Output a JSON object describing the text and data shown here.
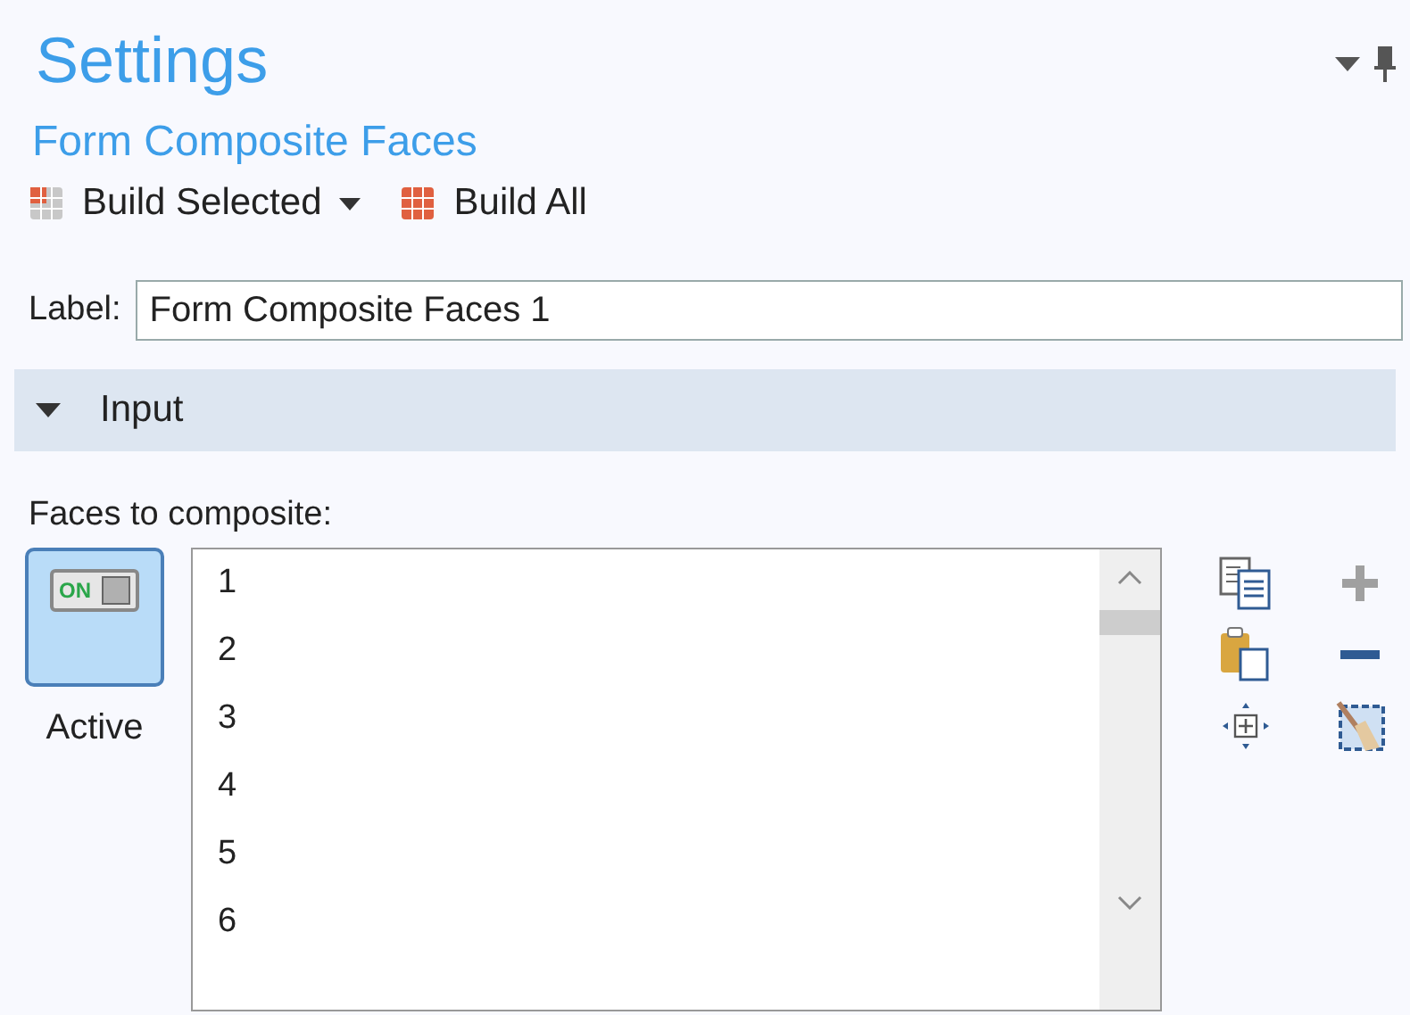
{
  "title": "Settings",
  "subtitle": "Form Composite Faces",
  "toolbar": [
    {
      "label": "Build Selected",
      "kind": "dropdown"
    },
    {
      "label": "Build All",
      "kind": "plain"
    }
  ],
  "label_field": {
    "label": "Label:",
    "value": "Form Composite Faces 1"
  },
  "section": {
    "title": "Input",
    "expanded": true
  },
  "selection": {
    "label": "Faces to composite:",
    "toggle": {
      "text": "ON",
      "on": true,
      "caption": "Active"
    },
    "items": [
      "1",
      "2",
      "3",
      "4",
      "5",
      "6"
    ],
    "tools": [
      {
        "kind": "copy",
        "disabled": false
      },
      {
        "kind": "add",
        "disabled": true
      },
      {
        "kind": "paste",
        "disabled": false
      },
      {
        "kind": "remove",
        "disabled": false
      },
      {
        "kind": "zoom",
        "disabled": false
      },
      {
        "kind": "clear",
        "disabled": false
      }
    ]
  }
}
